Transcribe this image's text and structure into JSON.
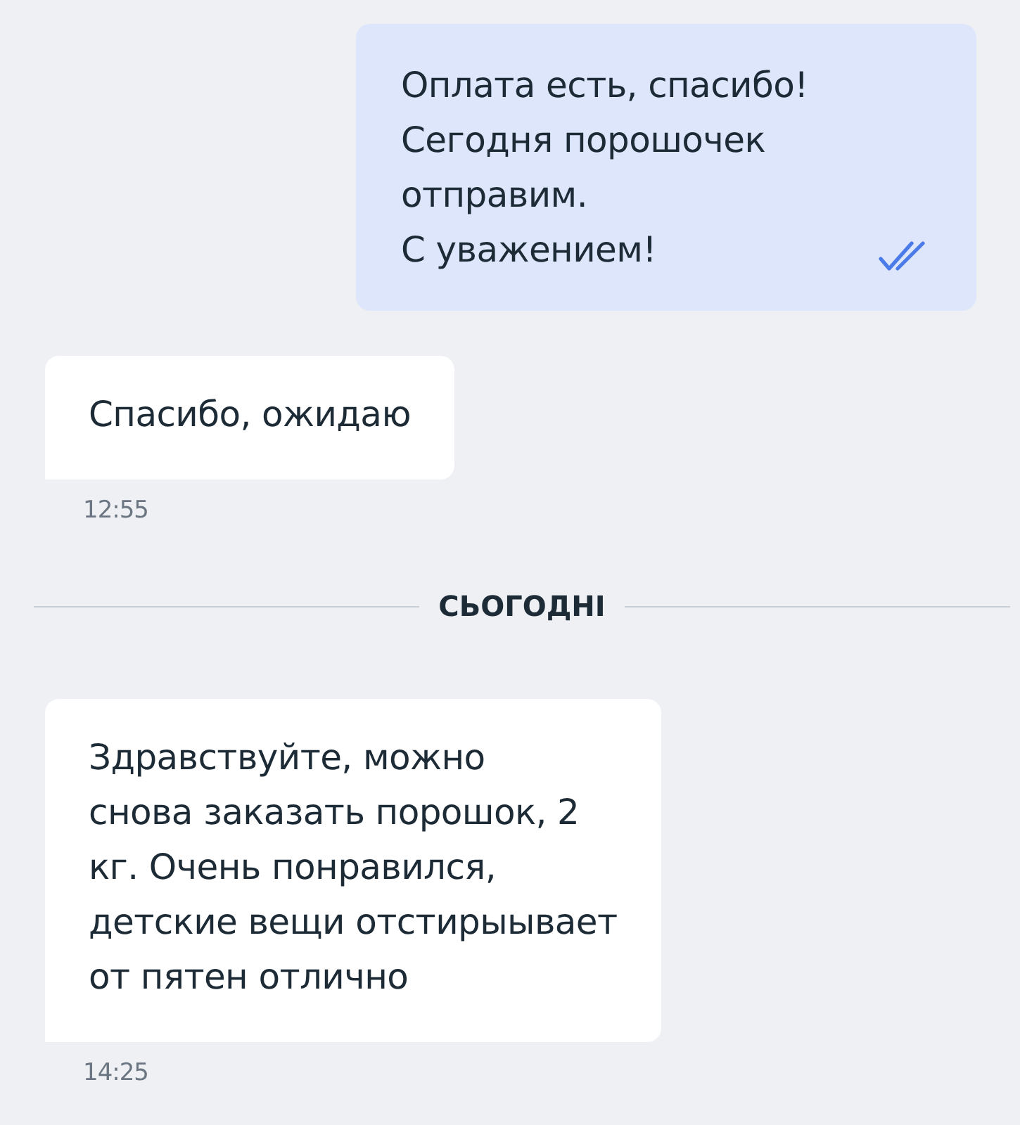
{
  "messages": [
    {
      "kind": "outgoing",
      "text": "Оплата есть, спасибо!\nСегодня порошочек\nотправим.\nС уважением!",
      "read": true
    },
    {
      "kind": "incoming",
      "text": "Спасибо, ожидаю",
      "time": "12:55"
    },
    {
      "kind": "divider",
      "label": "СЬОГОДНІ"
    },
    {
      "kind": "incoming",
      "text": "Здравствуйте, можно\nснова заказать порошок, 2\nкг. Очень понравился,\nдетские вещи отстирыывает\nот пятен отлично",
      "time": "14:25"
    }
  ]
}
